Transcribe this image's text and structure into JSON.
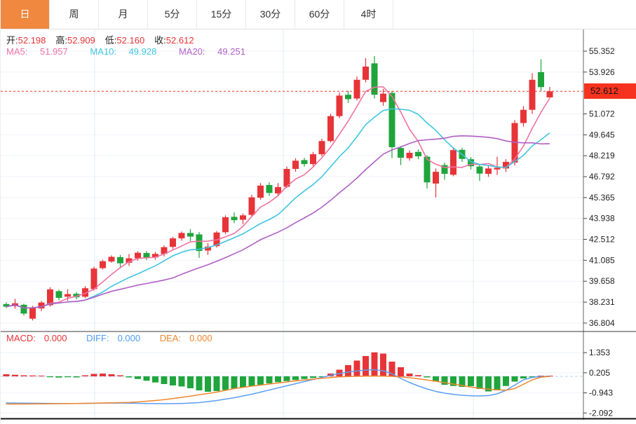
{
  "tabs": [
    {
      "label": "日",
      "active": true
    },
    {
      "label": "周",
      "active": false
    },
    {
      "label": "月",
      "active": false
    },
    {
      "label": "5分",
      "active": false
    },
    {
      "label": "15分",
      "active": false
    },
    {
      "label": "30分",
      "active": false
    },
    {
      "label": "60分",
      "active": false
    },
    {
      "label": "4时",
      "active": false
    }
  ],
  "ohlc": {
    "open_label": "开:",
    "open": "52.198",
    "high_label": "高:",
    "high": "52.909",
    "low_label": "低:",
    "low": "52.160",
    "close_label": "收:",
    "close": "52.612"
  },
  "ma_info": {
    "ma5_label": "MA5:",
    "ma5": "51.957",
    "ma10_label": "MA10:",
    "ma10": "49.928",
    "ma20_label": "MA20:",
    "ma20": "49.251"
  },
  "macd_info": {
    "macd_label": "MACD:",
    "macd": "0.000",
    "diff_label": "DIFF:",
    "diff": "0.000",
    "dea_label": "DEA:",
    "dea": "0.000"
  },
  "price_axis": {
    "last_price": "52.612"
  },
  "colors": {
    "up": "#e73438",
    "down": "#1fa53c",
    "ma5": "#f0719f",
    "ma10": "#3fc5e2",
    "ma20": "#b05fc6",
    "diff": "#5b9ff2",
    "dea": "#f0862d",
    "badge": "#f5331f",
    "dotted_line": "#f5331f",
    "tab_active_bg": "#f0883f",
    "grid": "#eef2f8",
    "vgrid": "#e3ebf3",
    "axis_text": "#222",
    "zero_line": "#aed6f1"
  },
  "chart_data": {
    "type": "candlestick",
    "timeframe_selected": "日",
    "legend": [
      "MA5",
      "MA10",
      "MA20",
      "MACD",
      "DIFF",
      "DEA"
    ],
    "price_ticks": [
      {
        "value": 55.352,
        "label": "55.352"
      },
      {
        "value": 53.926,
        "label": "53.926"
      },
      {
        "value": 52.499,
        "label": ""
      },
      {
        "value": 51.072,
        "label": "51.072"
      },
      {
        "value": 49.645,
        "label": "49.645"
      },
      {
        "value": 48.219,
        "label": "48.219"
      },
      {
        "value": 46.792,
        "label": "46.792"
      },
      {
        "value": 45.365,
        "label": "45.365"
      },
      {
        "value": 43.938,
        "label": "43.938"
      },
      {
        "value": 42.512,
        "label": "42.512"
      },
      {
        "value": 41.085,
        "label": "41.085"
      },
      {
        "value": 39.658,
        "label": "39.658"
      },
      {
        "value": 38.231,
        "label": "38.231"
      },
      {
        "value": 36.804,
        "label": "36.804"
      }
    ],
    "last_price": 52.612,
    "candles_ohlc": [
      [
        38.1,
        38.22,
        37.82,
        37.92
      ],
      [
        37.95,
        38.45,
        37.78,
        38.15
      ],
      [
        38.05,
        38.12,
        37.32,
        37.45
      ],
      [
        37.1,
        37.98,
        36.98,
        37.85
      ],
      [
        37.8,
        38.32,
        37.62,
        38.2
      ],
      [
        38.02,
        39.25,
        37.92,
        39.1
      ],
      [
        38.98,
        39.08,
        38.35,
        38.52
      ],
      [
        38.6,
        39.12,
        38.32,
        38.78
      ],
      [
        38.8,
        38.92,
        38.42,
        38.56
      ],
      [
        38.6,
        39.32,
        38.5,
        39.18
      ],
      [
        39.12,
        40.65,
        39.02,
        40.52
      ],
      [
        40.55,
        41.12,
        40.45,
        41.02
      ],
      [
        41.0,
        41.42,
        40.92,
        41.32
      ],
      [
        41.3,
        41.45,
        40.55,
        40.88
      ],
      [
        40.92,
        41.52,
        40.7,
        41.22
      ],
      [
        41.22,
        41.7,
        41.05,
        41.6
      ],
      [
        41.58,
        41.72,
        41.1,
        41.25
      ],
      [
        41.28,
        41.65,
        41.12,
        41.52
      ],
      [
        41.52,
        42.1,
        41.35,
        41.98
      ],
      [
        42.0,
        42.68,
        41.85,
        42.58
      ],
      [
        42.58,
        43.05,
        42.42,
        42.95
      ],
      [
        42.95,
        43.22,
        42.4,
        42.7
      ],
      [
        42.85,
        43.02,
        41.25,
        41.72
      ],
      [
        41.75,
        42.25,
        41.45,
        42.02
      ],
      [
        42.05,
        43.08,
        41.95,
        42.98
      ],
      [
        43.0,
        44.15,
        42.88,
        44.02
      ],
      [
        44.05,
        44.35,
        43.62,
        43.82
      ],
      [
        43.85,
        44.28,
        43.55,
        44.15
      ],
      [
        44.18,
        45.55,
        44.05,
        45.38
      ],
      [
        45.35,
        46.35,
        45.22,
        46.18
      ],
      [
        46.22,
        46.4,
        45.48,
        45.68
      ],
      [
        45.65,
        46.35,
        45.45,
        46.08
      ],
      [
        46.1,
        47.48,
        46.02,
        47.32
      ],
      [
        47.32,
        48.05,
        47.12,
        47.88
      ],
      [
        47.92,
        48.08,
        47.48,
        47.65
      ],
      [
        47.65,
        48.48,
        47.52,
        48.32
      ],
      [
        48.32,
        49.38,
        48.18,
        49.22
      ],
      [
        49.22,
        51.08,
        49.12,
        50.92
      ],
      [
        50.92,
        52.52,
        50.78,
        52.32
      ],
      [
        52.38,
        52.65,
        51.82,
        52.08
      ],
      [
        52.12,
        53.62,
        51.98,
        53.4
      ],
      [
        53.4,
        54.88,
        53.22,
        54.3
      ],
      [
        54.52,
        55.02,
        52.12,
        52.38
      ],
      [
        51.88,
        52.78,
        51.62,
        52.45
      ],
      [
        52.5,
        52.65,
        48.05,
        48.8
      ],
      [
        48.75,
        48.88,
        47.58,
        48.08
      ],
      [
        48.05,
        48.58,
        47.88,
        48.42
      ],
      [
        48.48,
        48.65,
        47.98,
        48.18
      ],
      [
        48.15,
        48.25,
        45.98,
        46.4
      ],
      [
        46.32,
        47.35,
        45.37,
        47.12
      ],
      [
        47.58,
        47.75,
        46.58,
        46.98
      ],
      [
        46.92,
        48.75,
        46.82,
        48.6
      ],
      [
        48.62,
        48.75,
        47.8,
        48.0
      ],
      [
        47.98,
        48.12,
        47.28,
        47.5
      ],
      [
        47.48,
        47.65,
        46.5,
        47.0
      ],
      [
        46.98,
        47.55,
        46.78,
        47.35
      ],
      [
        47.28,
        48.15,
        46.9,
        47.4
      ],
      [
        47.35,
        47.98,
        47.1,
        47.8
      ],
      [
        47.75,
        50.65,
        47.55,
        50.45
      ],
      [
        50.45,
        51.6,
        50.2,
        51.35
      ],
      [
        51.35,
        53.85,
        51.08,
        53.4
      ],
      [
        53.92,
        54.8,
        52.65,
        52.9
      ],
      [
        52.198,
        52.909,
        52.16,
        52.612
      ]
    ],
    "ma_periods": [
      5,
      10,
      20
    ],
    "ma_current": {
      "ma5": 51.957,
      "ma10": 49.928,
      "ma20": 49.251
    },
    "macd": {
      "axis_ticks": [
        {
          "value": 1.353,
          "label": "1.353"
        },
        {
          "value": 0.205,
          "label": "0.205"
        },
        {
          "value": -0.943,
          "label": "-0.943"
        },
        {
          "value": -2.092,
          "label": "-2.092"
        }
      ],
      "hist": [
        0.12,
        0.09,
        0.06,
        0.05,
        0.04,
        -0.05,
        -0.07,
        -0.05,
        -0.06,
        0.06,
        0.14,
        0.16,
        0.12,
        0.06,
        -0.06,
        -0.15,
        -0.25,
        -0.35,
        -0.44,
        -0.52,
        -0.58,
        -0.68,
        -0.8,
        -0.88,
        -0.84,
        -0.78,
        -0.7,
        -0.63,
        -0.56,
        -0.48,
        -0.4,
        -0.33,
        -0.27,
        -0.21,
        -0.15,
        -0.09,
        -0.04,
        0.16,
        0.38,
        0.64,
        0.9,
        1.16,
        1.37,
        1.3,
        0.84,
        0.52,
        0.16,
        0.07,
        -0.06,
        -0.3,
        -0.48,
        -0.55,
        -0.6,
        -0.56,
        -0.72,
        -0.86,
        -0.8,
        -0.55,
        -0.3,
        -0.12,
        -0.05,
        0.03,
        0.01
      ],
      "diff": [
        -1.52,
        -1.525,
        -1.53,
        -1.535,
        -1.54,
        -1.545,
        -1.55,
        -1.55,
        -1.55,
        -1.545,
        -1.54,
        -1.53,
        -1.52,
        -1.525,
        -1.53,
        -1.54,
        -1.55,
        -1.555,
        -1.56,
        -1.555,
        -1.55,
        -1.525,
        -1.5,
        -1.44,
        -1.38,
        -1.3,
        -1.22,
        -1.12,
        -1.02,
        -0.9,
        -0.78,
        -0.66,
        -0.54,
        -0.42,
        -0.3,
        -0.18,
        -0.06,
        0.06,
        0.16,
        0.24,
        0.31,
        0.36,
        0.38,
        0.32,
        0.15,
        -0.12,
        -0.35,
        -0.55,
        -0.72,
        -0.86,
        -0.96,
        -1.03,
        -1.08,
        -1.11,
        -1.12,
        -1.1,
        -1.0,
        -0.8,
        -0.5,
        -0.2,
        -0.06,
        -0.01,
        0.0
      ],
      "dea": [
        -1.58,
        -1.58,
        -1.58,
        -1.575,
        -1.57,
        -1.565,
        -1.56,
        -1.555,
        -1.55,
        -1.54,
        -1.53,
        -1.52,
        -1.51,
        -1.5,
        -1.49,
        -1.46,
        -1.42,
        -1.38,
        -1.33,
        -1.27,
        -1.2,
        -1.13,
        -1.05,
        -0.98,
        -0.9,
        -0.8,
        -0.7,
        -0.63,
        -0.56,
        -0.5,
        -0.44,
        -0.38,
        -0.32,
        -0.26,
        -0.21,
        -0.16,
        -0.11,
        -0.07,
        -0.03,
        -0.01,
        0.0,
        0.01,
        0.02,
        0.01,
        0.0,
        -0.03,
        -0.08,
        -0.14,
        -0.21,
        -0.28,
        -0.36,
        -0.44,
        -0.52,
        -0.61,
        -0.68,
        -0.73,
        -0.77,
        -0.79,
        -0.7,
        -0.45,
        -0.2,
        -0.05,
        0.0
      ]
    }
  }
}
